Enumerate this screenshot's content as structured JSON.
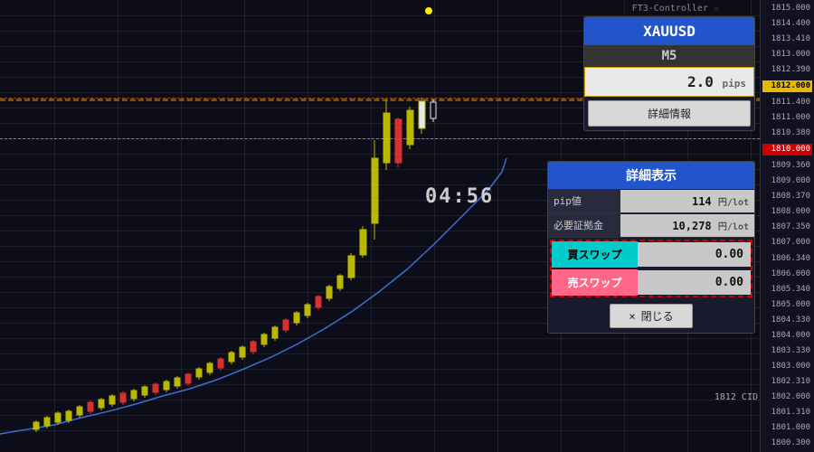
{
  "chart": {
    "time": "04:56",
    "symbol": "XAUUSD",
    "timeframe": "M5",
    "pips": "2.0",
    "pips_unit": "pips",
    "ft3_label": "FT3-Controller ☆",
    "cid_label": "1812 CID"
  },
  "main_panel": {
    "symbol": "XAUUSD",
    "timeframe": "M5",
    "pips": "2.0",
    "pips_unit": "pips",
    "detail_button": "詳細情報"
  },
  "detail_panel": {
    "header": "詳細表示",
    "pip_label": "pip値",
    "pip_value": "114",
    "pip_unit": "円/lot",
    "margin_label": "必要証拠金",
    "margin_value": "10,278",
    "margin_unit": "円/lot",
    "buy_swap_label": "買スワップ",
    "buy_swap_value": "0.00",
    "sell_swap_label": "売スワップ",
    "sell_swap_value": "0.00",
    "close_button": "閉じる",
    "close_x": "×"
  },
  "price_axis": {
    "prices": [
      {
        "value": "1815.000",
        "highlight": false
      },
      {
        "value": "1814.400",
        "highlight": false
      },
      {
        "value": "1813.410",
        "highlight": false
      },
      {
        "value": "1813.000",
        "highlight": false
      },
      {
        "value": "1812.390",
        "highlight": false
      },
      {
        "value": "1812.000",
        "highlight": "gold"
      },
      {
        "value": "1811.400",
        "highlight": false
      },
      {
        "value": "1811.000",
        "highlight": false
      },
      {
        "value": "1810.380",
        "highlight": false
      },
      {
        "value": "1810.000",
        "highlight": "red"
      },
      {
        "value": "1809.360",
        "highlight": false
      },
      {
        "value": "1809.000",
        "highlight": false
      },
      {
        "value": "1808.370",
        "highlight": false
      },
      {
        "value": "1808.000",
        "highlight": false
      },
      {
        "value": "1807.350",
        "highlight": false
      },
      {
        "value": "1807.000",
        "highlight": false
      },
      {
        "value": "1806.340",
        "highlight": false
      },
      {
        "value": "1806.000",
        "highlight": false
      },
      {
        "value": "1805.340",
        "highlight": false
      },
      {
        "value": "1805.000",
        "highlight": false
      },
      {
        "value": "1804.330",
        "highlight": false
      },
      {
        "value": "1804.000",
        "highlight": false
      },
      {
        "value": "1803.330",
        "highlight": false
      },
      {
        "value": "1803.000",
        "highlight": false
      },
      {
        "value": "1802.310",
        "highlight": false
      },
      {
        "value": "1802.000",
        "highlight": false
      },
      {
        "value": "1801.310",
        "highlight": false
      },
      {
        "value": "1801.000",
        "highlight": false
      },
      {
        "value": "1800.300",
        "highlight": false
      }
    ]
  }
}
